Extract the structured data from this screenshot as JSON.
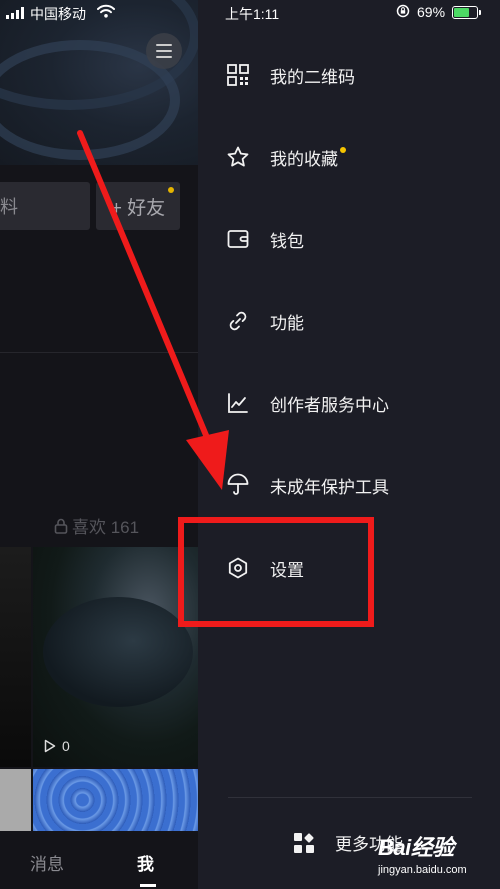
{
  "status_bar": {
    "carrier": "中国移动",
    "time": "上午1:11",
    "battery_percent": "69%",
    "battery_level": 0.69
  },
  "profile": {
    "edit_button_label": "料",
    "add_friend_label": "+ 好友",
    "likes_label": "喜欢 161",
    "video_play_count": "0"
  },
  "tab_bar": {
    "messages": "消息",
    "me": "我"
  },
  "drawer": {
    "items": [
      {
        "icon": "qr-code-icon",
        "label": "我的二维码"
      },
      {
        "icon": "star-icon",
        "label": "我的收藏",
        "badge": true
      },
      {
        "icon": "wallet-icon",
        "label": "钱包"
      },
      {
        "icon": "link-icon",
        "label": "功能"
      },
      {
        "icon": "chart-line-icon",
        "label": "创作者服务中心"
      },
      {
        "icon": "umbrella-icon",
        "label": "未成年保护工具"
      },
      {
        "icon": "hexagon-settings-icon",
        "label": "设置"
      }
    ],
    "more_label": "更多功能"
  },
  "watermark": {
    "logo": "Bai经验",
    "site": "jingyan.baidu.com"
  },
  "colors": {
    "drawer_bg": "#1c1d26",
    "annotation_red": "#ef1b1b",
    "badge_yellow": "#f5c400",
    "battery_green": "#4cd964"
  }
}
